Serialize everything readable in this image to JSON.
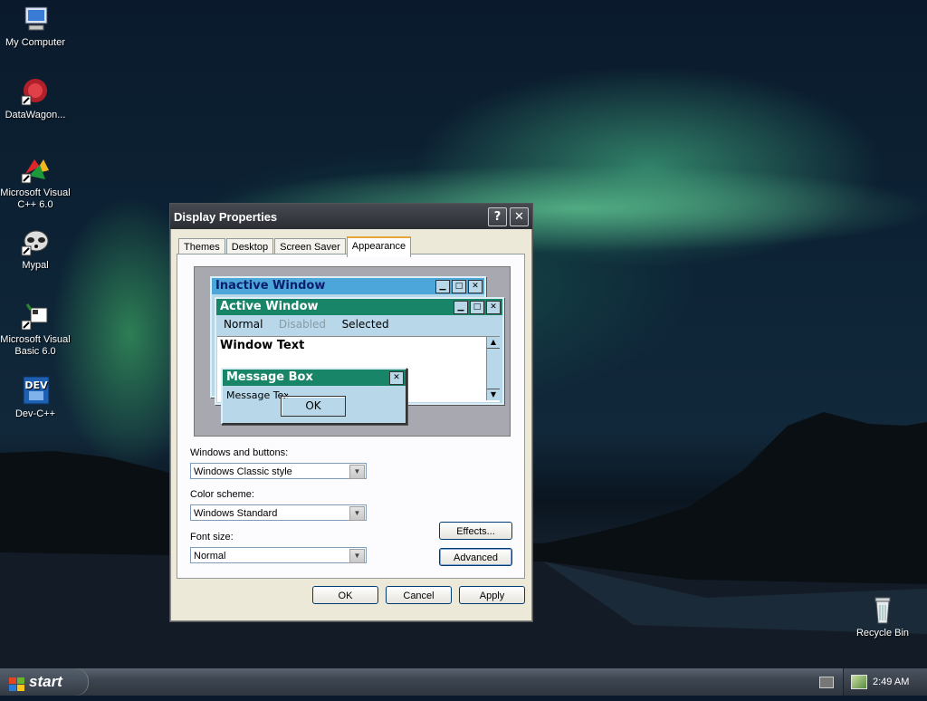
{
  "desktop": {
    "icons": [
      {
        "label": "My Computer"
      },
      {
        "label": "DataWagon..."
      },
      {
        "label": "Microsoft Visual C++ 6.0"
      },
      {
        "label": "Mypal"
      },
      {
        "label": "Microsoft Visual Basic 6.0"
      },
      {
        "label": "Dev-C++",
        "glyph": "DEV"
      },
      {
        "label": "Recycle Bin"
      }
    ]
  },
  "dialog": {
    "title": "Display Properties",
    "help_glyph": "?",
    "close_glyph": "✕",
    "tabs": [
      "Themes",
      "Desktop",
      "Screen Saver",
      "Appearance"
    ],
    "active_tab": "Appearance",
    "preview": {
      "inactive_title": "Inactive Window",
      "active_title": "Active Window",
      "menu": {
        "normal": "Normal",
        "disabled": "Disabled",
        "selected": "Selected"
      },
      "window_text": "Window Text",
      "message_box_title": "Message Box",
      "message_text": "Message Text",
      "ok": "OK"
    },
    "windows_buttons": {
      "label": "Windows and buttons:",
      "value": "Windows Classic style"
    },
    "color_scheme": {
      "label": "Color scheme:",
      "value": "Windows Standard"
    },
    "font_size": {
      "label": "Font size:",
      "value": "Normal"
    },
    "effects_label": "Effects...",
    "advanced_label": "Advanced",
    "ok_label": "OK",
    "cancel_label": "Cancel",
    "apply_label": "Apply"
  },
  "taskbar": {
    "start_label": "start",
    "clock": "2:49 AM"
  },
  "colors": {
    "preview_title_inactive": "#4da6d9",
    "preview_title_active": "#188468",
    "preview_bg": "#b8d8ea",
    "tab_highlight": "#e6a63b"
  }
}
